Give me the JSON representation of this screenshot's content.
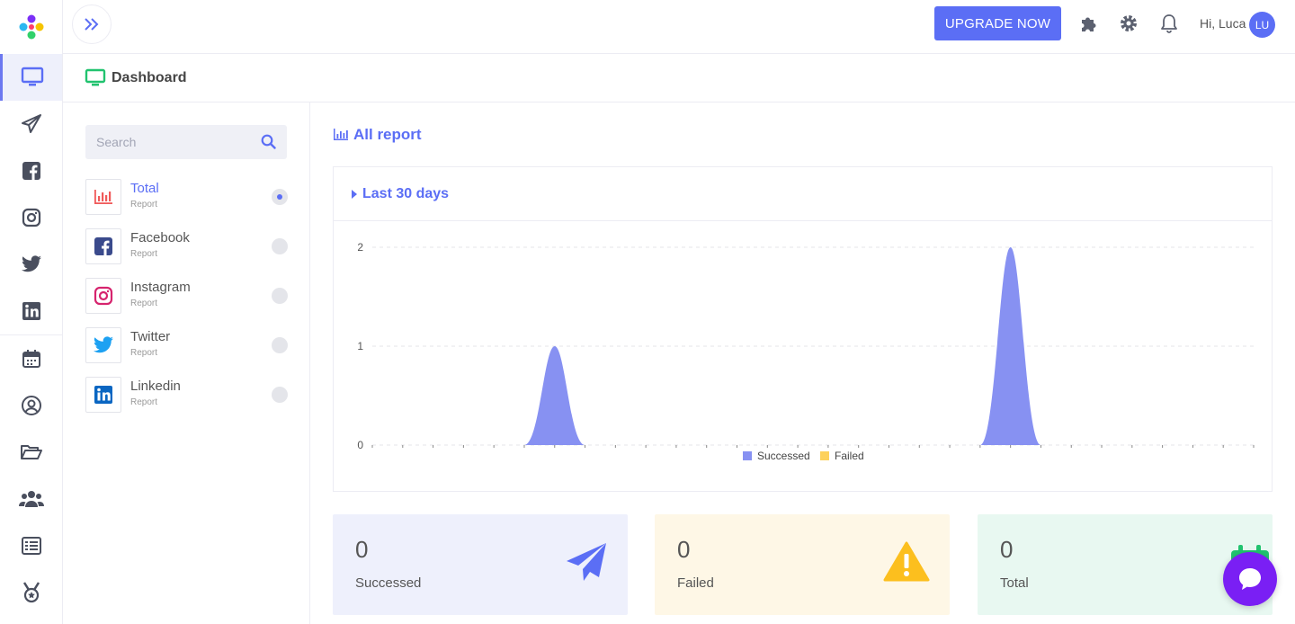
{
  "topbar": {
    "upgrade_label": "UPGRADE NOW",
    "greeting": "Hi, Luca",
    "avatar_initials": "LU"
  },
  "page": {
    "title": "Dashboard"
  },
  "search": {
    "placeholder": "Search"
  },
  "reports": [
    {
      "name": "Total",
      "sub": "Report",
      "active": true,
      "icon": "bar-chart-icon"
    },
    {
      "name": "Facebook",
      "sub": "Report",
      "active": false,
      "icon": "facebook-icon"
    },
    {
      "name": "Instagram",
      "sub": "Report",
      "active": false,
      "icon": "instagram-icon"
    },
    {
      "name": "Twitter",
      "sub": "Report",
      "active": false,
      "icon": "twitter-icon"
    },
    {
      "name": "Linkedin",
      "sub": "Report",
      "active": false,
      "icon": "linkedin-icon"
    }
  ],
  "main": {
    "report_title": "All report",
    "range_label": "Last 30 days"
  },
  "chart_data": {
    "type": "area",
    "x": [
      0,
      1,
      2,
      3,
      4,
      5,
      6,
      7,
      8,
      9,
      10,
      11,
      12,
      13,
      14,
      15,
      16,
      17,
      18,
      19,
      20,
      21,
      22,
      23,
      24,
      25,
      26,
      27,
      28,
      29
    ],
    "series": [
      {
        "name": "Successed",
        "color": "#8791f2",
        "values": [
          0,
          0,
          0,
          0,
          0,
          0,
          1,
          0,
          0,
          0,
          0,
          0,
          0,
          0,
          0,
          0,
          0,
          0,
          0,
          0,
          0,
          2,
          0,
          0,
          0,
          0,
          0,
          0,
          0,
          0
        ]
      },
      {
        "name": "Failed",
        "color": "#fdd15c",
        "values": [
          0,
          0,
          0,
          0,
          0,
          0,
          0,
          0,
          0,
          0,
          0,
          0,
          0,
          0,
          0,
          0,
          0,
          0,
          0,
          0,
          0,
          0,
          0,
          0,
          0,
          0,
          0,
          0,
          0,
          0
        ]
      }
    ],
    "yticks": [
      "0",
      "1",
      "2"
    ],
    "ylim": [
      0,
      2
    ],
    "grid": true,
    "legend": "bottom-center"
  },
  "stats": [
    {
      "value": "0",
      "label": "Successed",
      "bg": "#eef0fc",
      "icon": "paper-plane-icon",
      "color": "#5b6ef5"
    },
    {
      "value": "0",
      "label": "Failed",
      "bg": "#fef7e6",
      "icon": "warning-icon",
      "color": "#fcbf1e"
    },
    {
      "value": "0",
      "label": "Total",
      "bg": "#e8f8f1",
      "icon": "calendar-icon",
      "color": "#21c36f"
    }
  ]
}
